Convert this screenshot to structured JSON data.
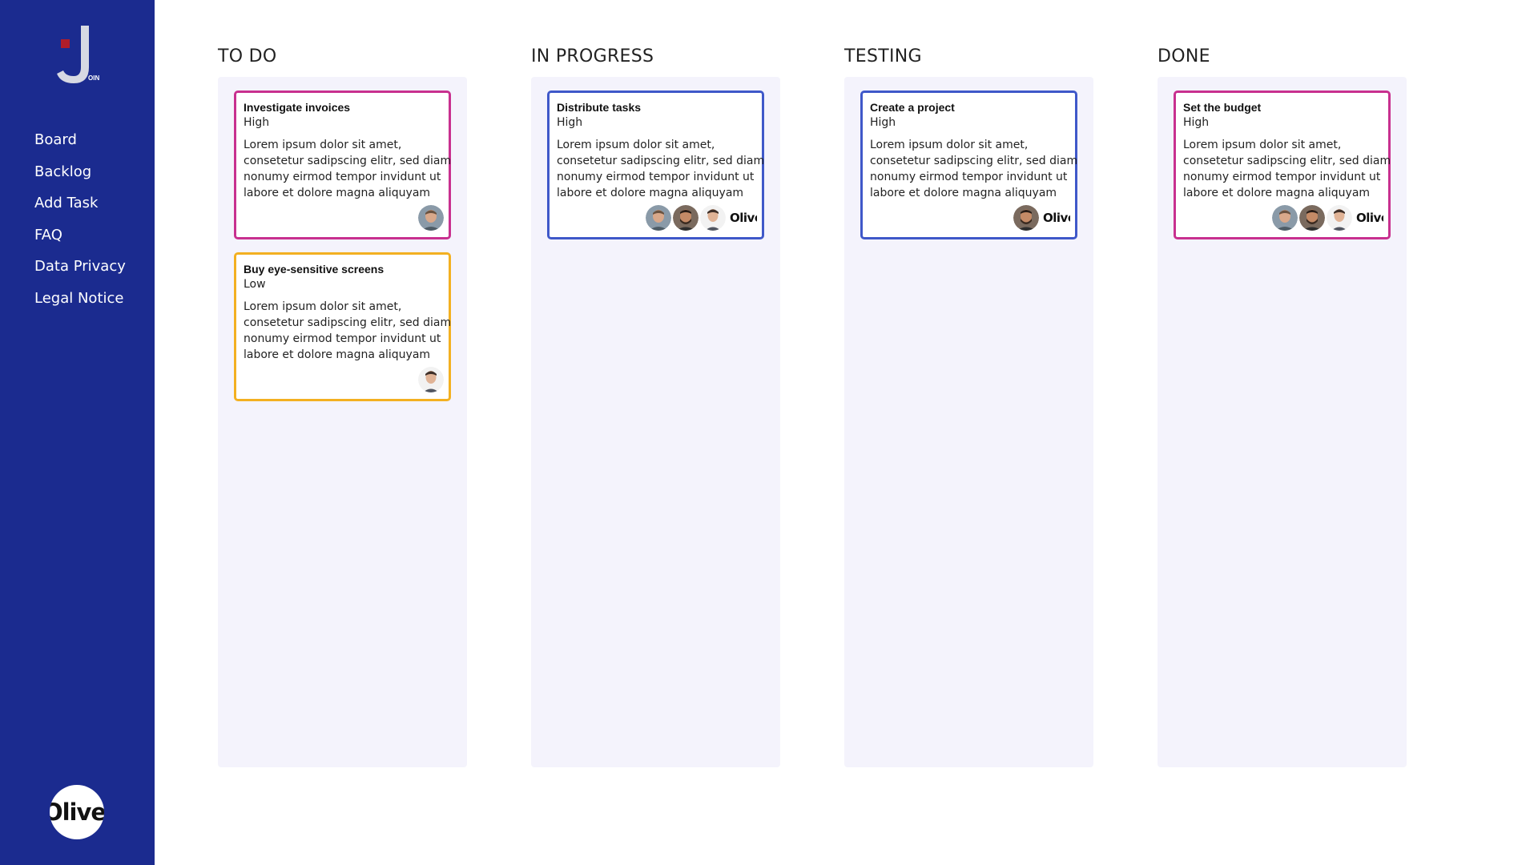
{
  "sidebar": {
    "logo_text": "J",
    "logo_sub": "OIN",
    "nav": [
      {
        "label": "Board"
      },
      {
        "label": "Backlog"
      },
      {
        "label": "Add Task"
      },
      {
        "label": "FAQ"
      },
      {
        "label": "Data Privacy"
      },
      {
        "label": "Legal Notice"
      }
    ],
    "user_badge": "Olive",
    "colors": {
      "background": "#1b2b8f",
      "logo_accent": "#b01d2a"
    }
  },
  "board": {
    "columns": [
      {
        "title": "TO DO",
        "cards": [
          {
            "title": "Investigate invoices",
            "priority": "High",
            "border_color": "#c8308f",
            "description": [
              "Lorem ipsum dolor sit amet,",
              "consetetur sadipscing elitr, sed diam",
              "nonumy eirmod tempor invidunt ut",
              "labore et dolore magna aliquyam"
            ],
            "assignees": [
              "avatar-light"
            ]
          },
          {
            "title": "Buy eye-sensitive screens",
            "priority": "Low",
            "border_color": "#f3b021",
            "description": [
              "Lorem ipsum dolor sit amet,",
              "consetetur sadipscing elitr, sed diam",
              "nonumy eirmod tempor invidunt ut",
              "labore et dolore magna aliquyam"
            ],
            "assignees": [
              "avatar-white"
            ]
          }
        ]
      },
      {
        "title": "IN PROGRESS",
        "cards": [
          {
            "title": "Distribute tasks",
            "priority": "High",
            "border_color": "#3f58c9",
            "description": [
              "Lorem ipsum dolor sit amet,",
              "consetetur sadipscing elitr, sed diam",
              "nonumy eirmod tempor invidunt ut",
              "labore et dolore magna aliquyam"
            ],
            "assignees": [
              "avatar-light",
              "avatar-dark",
              "avatar-white"
            ],
            "live_label": "Olive"
          }
        ]
      },
      {
        "title": "TESTING",
        "cards": [
          {
            "title": "Create a project",
            "priority": "High",
            "border_color": "#3f58c9",
            "description": [
              "Lorem ipsum dolor sit amet,",
              "consetetur sadipscing elitr, sed diam",
              "nonumy eirmod tempor invidunt ut",
              "labore et dolore magna aliquyam"
            ],
            "assignees": [
              "avatar-dark"
            ],
            "live_label": "Olive"
          }
        ]
      },
      {
        "title": "DONE",
        "cards": [
          {
            "title": "Set the budget",
            "priority": "High",
            "border_color": "#c8308f",
            "description": [
              "Lorem ipsum dolor sit amet,",
              "consetetur sadipscing elitr, sed diam",
              "nonumy eirmod tempor invidunt ut",
              "labore et dolore magna aliquyam"
            ],
            "assignees": [
              "avatar-light",
              "avatar-dark",
              "avatar-white"
            ],
            "live_label": "Olive"
          }
        ]
      }
    ]
  }
}
